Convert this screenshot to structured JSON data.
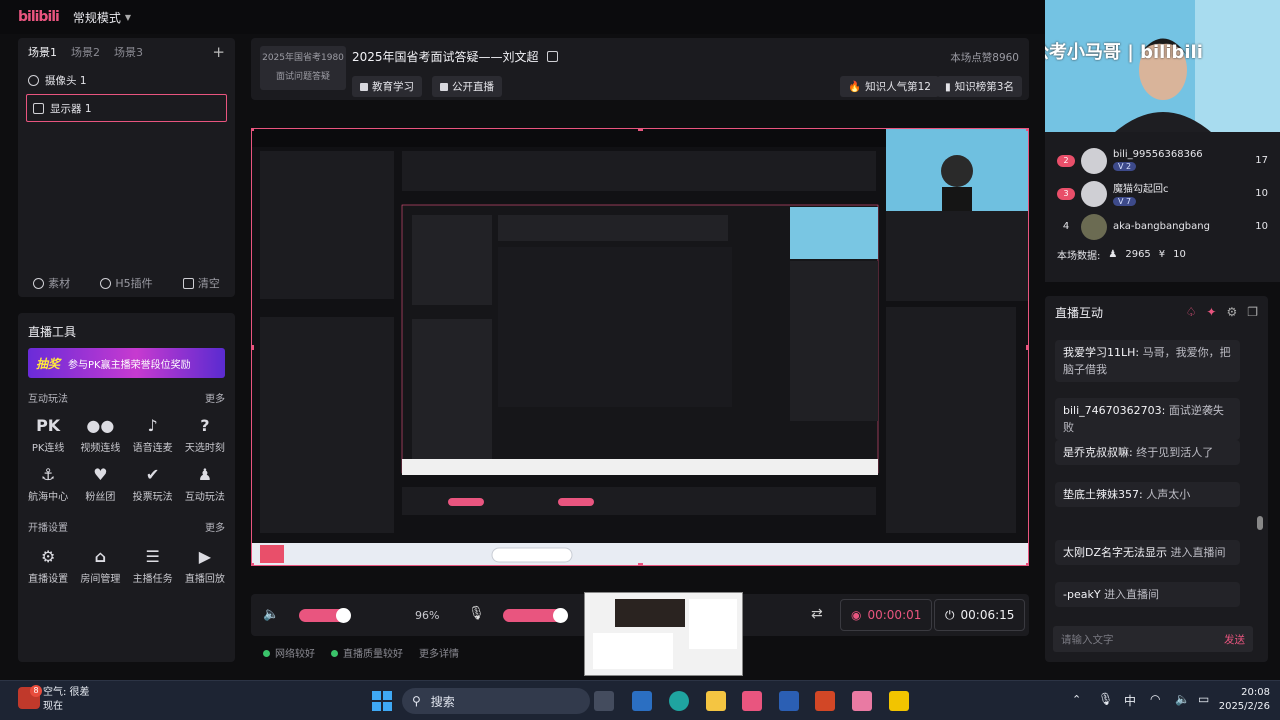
{
  "app": {
    "logo": "bilibili",
    "mode": "常规模式"
  },
  "scenes": {
    "tabs": [
      "场景1",
      "场景2",
      "场景3"
    ],
    "add": "+"
  },
  "sources": [
    {
      "label": "摄像头 1"
    },
    {
      "label": "显示器 1"
    }
  ],
  "source_tools": [
    "素材",
    "H5插件",
    "清空"
  ],
  "live_tools": {
    "title": "直播工具",
    "banner_badge": "抽奖",
    "banner_text": "参与PK赢主播荣誉段位奖励",
    "interactive": {
      "title": "互动玩法",
      "more": "更多",
      "items": [
        "PK连线",
        "视频连线",
        "语音连麦",
        "天选时刻",
        "航海中心",
        "粉丝团",
        "投票玩法",
        "互动玩法"
      ]
    },
    "broadcast": {
      "title": "开播设置",
      "more": "更多",
      "items": [
        "直播设置",
        "房间管理",
        "主播任务",
        "直播回放"
      ]
    }
  },
  "room": {
    "cover_line1": "2025年国省考1980",
    "cover_line2": "面试问题答疑",
    "title": "2025年国省考面试答疑——刘文超",
    "likes": "本场点赞8960",
    "tags": [
      "教育学习",
      "公开直播"
    ],
    "popularity": "知识人气第12",
    "rank": "知识榜第3名"
  },
  "controls": {
    "volume": "96%",
    "volume_level": 0.55,
    "mic_level": 0.7,
    "record_time": "00:00:01",
    "live_time": "00:06:15"
  },
  "status": [
    "网络较好",
    "直播质量较好",
    "更多详情"
  ],
  "webcam": {
    "overlay": "公考小马哥 | bilibili"
  },
  "ranking": {
    "rows": [
      {
        "badge": "2",
        "name": "bili_99556368366",
        "level": "2",
        "score": "17"
      },
      {
        "badge": "3",
        "name": "魔猫勾起回c",
        "level": "7",
        "score": "10"
      },
      {
        "badge": "4",
        "name": "aka-bangbangbang",
        "level": "",
        "score": "10"
      }
    ],
    "summary_label": "本场数据:",
    "viewers": "2965",
    "coins": "10"
  },
  "chat": {
    "title": "直播互动",
    "messages": [
      {
        "user": "我爱学习11LH:",
        "text": "马哥，我爱你，把脑子借我"
      },
      {
        "user": "bili_74670362703:",
        "text": "面试逆袭失败"
      },
      {
        "user": "是乔克叔叔嘛:",
        "text": "终于见到活人了"
      },
      {
        "user": "垫底土辣妹357:",
        "text": "人声太小"
      },
      {
        "user": "太刚DZ名字无法显示",
        "text": "进入直播间"
      },
      {
        "user": "-peakY",
        "text": "进入直播间"
      }
    ],
    "placeholder": "请输入文字",
    "send": "发送"
  },
  "taskbar": {
    "weather_badge": "8",
    "weather_title": "空气: 很差",
    "weather_sub": "现在",
    "search": "搜索",
    "ime": "中",
    "time": "20:08",
    "date": "2025/2/26"
  },
  "colors": {
    "accent": "#e9557f",
    "panel": "#1b1b1f",
    "bg": "#0e0e10"
  }
}
